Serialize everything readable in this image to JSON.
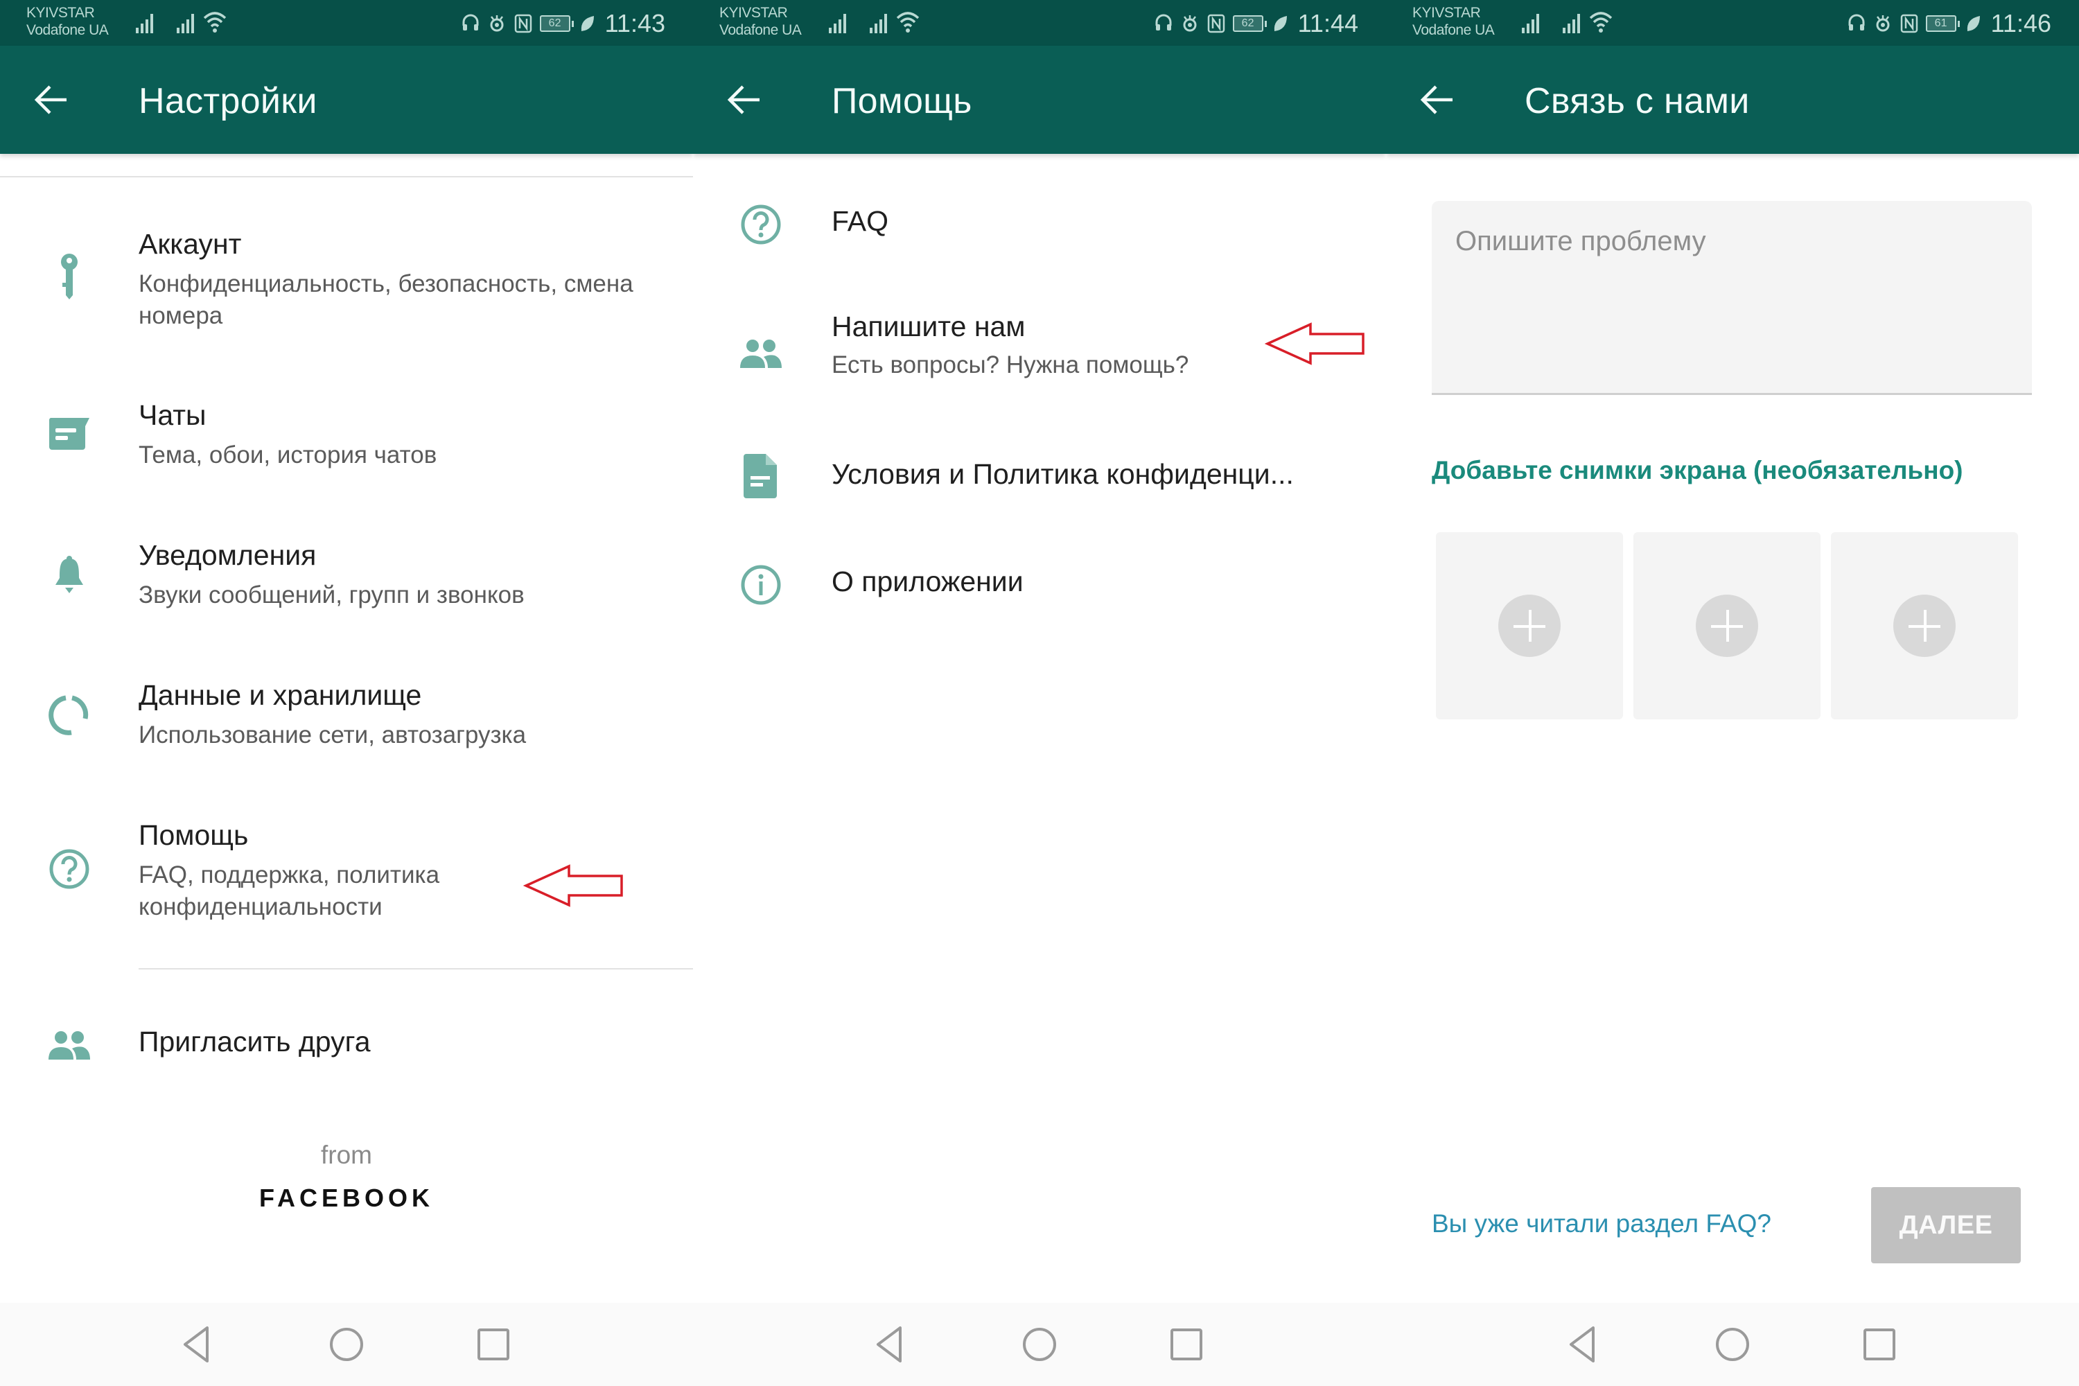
{
  "colors": {
    "status_bar": "#075048",
    "app_bar": "#0a5e55",
    "icon_teal": "#6fb0a4",
    "accent_green": "#1a8a7c",
    "link_blue": "#2b8fb0",
    "annotation_red": "#d81e28",
    "disabled_button": "#c0c0c0"
  },
  "screens": [
    {
      "status": {
        "carrier1": "KYIVSTAR",
        "carrier2": "Vodafone UA",
        "battery": "62",
        "time": "11:43"
      },
      "title": "Настройки",
      "items": [
        {
          "icon": "key-icon",
          "title": "Аккаунт",
          "subtitle": "Конфиденциальность, безопасность, смена номера"
        },
        {
          "icon": "chat-icon",
          "title": "Чаты",
          "subtitle": "Тема, обои, история чатов"
        },
        {
          "icon": "bell-icon",
          "title": "Уведомления",
          "subtitle": "Звуки сообщений, групп и звонков"
        },
        {
          "icon": "data-usage-icon",
          "title": "Данные и хранилище",
          "subtitle": "Использование сети, автозагрузка"
        },
        {
          "icon": "help-icon",
          "title": "Помощь",
          "subtitle": "FAQ, поддержка, политика конфиденциальности"
        },
        {
          "icon": "people-icon",
          "title": "Пригласить друга"
        }
      ],
      "footer": {
        "from": "from",
        "brand": "FACEBOOK"
      }
    },
    {
      "status": {
        "carrier1": "KYIVSTAR",
        "carrier2": "Vodafone UA",
        "battery": "62",
        "time": "11:44"
      },
      "title": "Помощь",
      "items": [
        {
          "icon": "help-icon",
          "title": "FAQ"
        },
        {
          "icon": "people-icon",
          "title": "Напишите нам",
          "subtitle": "Есть вопросы? Нужна помощь?"
        },
        {
          "icon": "document-icon",
          "title": "Условия и Политика конфиденци..."
        },
        {
          "icon": "info-icon",
          "title": "О приложении"
        }
      ]
    },
    {
      "status": {
        "carrier1": "KYIVSTAR",
        "carrier2": "Vodafone UA",
        "battery": "61",
        "time": "11:46"
      },
      "title": "Связь с нами",
      "form": {
        "description_placeholder": "Опишите проблему",
        "description_value": "",
        "screenshots_label": "Добавьте снимки экрана (необязательно)",
        "screenshot_slots": 3,
        "faq_link": "Вы уже читали раздел FAQ?",
        "next_button": "ДАЛЕЕ"
      }
    }
  ]
}
